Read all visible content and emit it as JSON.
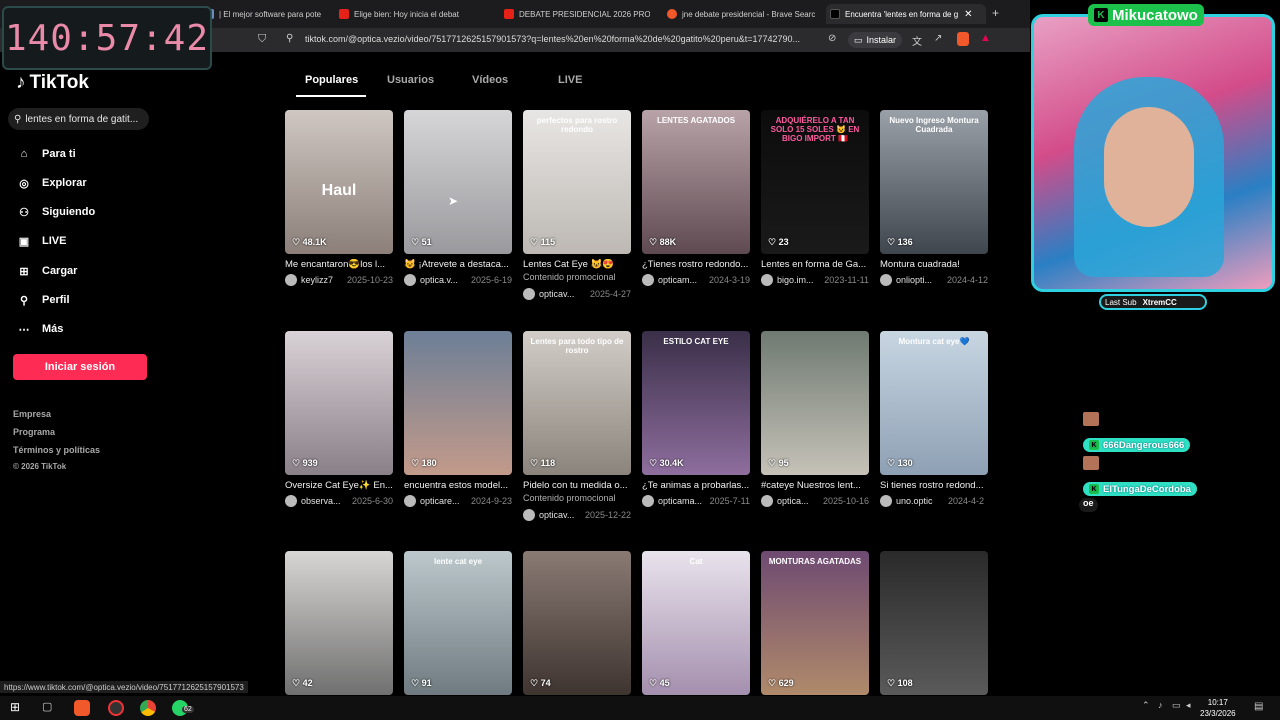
{
  "timer": "140:57:42",
  "browser": {
    "tabs": [
      {
        "label": "| El mejor software para pote",
        "color": "#6c8ebf"
      },
      {
        "label": "Elige bien: Hoy inicia el debat",
        "color": "#e62117"
      },
      {
        "label": "DEBATE PRESIDENCIAL 2026 PROPU",
        "color": "#e62117"
      },
      {
        "label": "jne debate presidencial - Brave Searc",
        "color": "#f1592a"
      },
      {
        "label": "Encuentra 'lentes en forma de g",
        "color": "#000000"
      }
    ],
    "url": "tiktok.com/@optica.vezio/video/7517712625157901573?q=lentes%20en%20forma%20de%20gatito%20peru&t=17742790...",
    "install_label": "Instalar"
  },
  "sidebar": {
    "logo": "TikTok",
    "search_value": "lentes en forma de gatit...",
    "nav": [
      {
        "label": "Para ti",
        "icon": "home-icon"
      },
      {
        "label": "Explorar",
        "icon": "compass-icon"
      },
      {
        "label": "Siguiendo",
        "icon": "following-icon"
      },
      {
        "label": "LIVE",
        "icon": "live-icon"
      },
      {
        "label": "Cargar",
        "icon": "upload-icon"
      },
      {
        "label": "Perfil",
        "icon": "profile-icon"
      },
      {
        "label": "Más",
        "icon": "more-icon"
      }
    ],
    "login_label": "Iniciar sesión",
    "footer": [
      "Empresa",
      "Programa",
      "Términos y políticas",
      "© 2026 TikTok"
    ]
  },
  "content_tabs": [
    "Populares",
    "Usuarios",
    "Vídeos",
    "LIVE"
  ],
  "videos": [
    {
      "likes": "48.1K",
      "caption": "Me encantaron😎los l...",
      "user": "keylizz7",
      "date": "2025-10-23",
      "overlay": "Haul",
      "promo": ""
    },
    {
      "likes": "51",
      "caption": "😺 ¡Atrevete a destaca...",
      "user": "optica.v...",
      "date": "2025-6-19",
      "overlay": "",
      "promo": ""
    },
    {
      "likes": "115",
      "caption": "Lentes Cat Eye 😺😍",
      "user": "opticav...",
      "date": "2025-4-27",
      "overlay": "perfectos para rostro redondo",
      "promo": "Contenido promocional"
    },
    {
      "likes": "88K",
      "caption": "¿Tienes rostro redondo...",
      "user": "opticam...",
      "date": "2024-3-19",
      "overlay": "LENTES AGATADOS",
      "promo": ""
    },
    {
      "likes": "23",
      "caption": "Lentes en forma de Ga...",
      "user": "bigo.im...",
      "date": "2023-11-11",
      "overlay": "ADQUIÉRELO A TAN SOLO 15 SOLES 😺 EN BIGO IMPORT 🇵🇪",
      "promo": ""
    },
    {
      "likes": "136",
      "caption": "Montura cuadrada!",
      "user": "onliopti...",
      "date": "2024-4-12",
      "overlay": "Nuevo Ingreso Montura Cuadrada",
      "promo": ""
    },
    {
      "likes": "939",
      "caption": "Oversize Cat Eye✨ En...",
      "user": "observa...",
      "date": "2025-6-30",
      "overlay": "",
      "promo": ""
    },
    {
      "likes": "180",
      "caption": "encuentra estos model...",
      "user": "opticare...",
      "date": "2024-9-23",
      "overlay": "",
      "promo": ""
    },
    {
      "likes": "118",
      "caption": "Pidelo con tu medida o...",
      "user": "opticav...",
      "date": "2025-12-22",
      "overlay": "Lentes para todo tipo de rostro",
      "promo": "Contenido promocional"
    },
    {
      "likes": "30.4K",
      "caption": "¿Te animas a probarlas...",
      "user": "opticama...",
      "date": "2025-7-11",
      "overlay": "ESTILO CAT EYE",
      "promo": ""
    },
    {
      "likes": "95",
      "caption": "#cateye Nuestros lent...",
      "user": "optica...",
      "date": "2025-10-16",
      "overlay": "",
      "promo": ""
    },
    {
      "likes": "130",
      "caption": "Si tienes rostro redond...",
      "user": "uno.optic",
      "date": "2024-4-2",
      "overlay": "Montura cat eye💙",
      "promo": ""
    },
    {
      "likes": "42",
      "caption": "",
      "user": "",
      "date": "",
      "overlay": "",
      "promo": ""
    },
    {
      "likes": "91",
      "caption": "",
      "user": "",
      "date": "",
      "overlay": "lente cat eye",
      "promo": ""
    },
    {
      "likes": "74",
      "caption": "",
      "user": "",
      "date": "",
      "overlay": "",
      "promo": ""
    },
    {
      "likes": "45",
      "caption": "",
      "user": "",
      "date": "",
      "overlay": "Cat",
      "promo": ""
    },
    {
      "likes": "629",
      "caption": "",
      "user": "",
      "date": "",
      "overlay": "MONTURAS AGATADAS",
      "promo": ""
    },
    {
      "likes": "108",
      "caption": "",
      "user": "",
      "date": "",
      "overlay": "",
      "promo": ""
    }
  ],
  "overlay": {
    "streamer": "Mikucatowo",
    "last_sub_label": "Last Sub",
    "last_sub_user": "XtremCC",
    "chat": [
      {
        "user": "666Dangerous666"
      },
      {
        "user": "ElTungaDeCordoba",
        "message": "oe"
      }
    ]
  },
  "status_url": "https://www.tiktok.com/@optica.vezio/video/7517712625157901573",
  "taskbar": {
    "badge": "62",
    "time": "10:17",
    "date": "23/3/2026"
  }
}
